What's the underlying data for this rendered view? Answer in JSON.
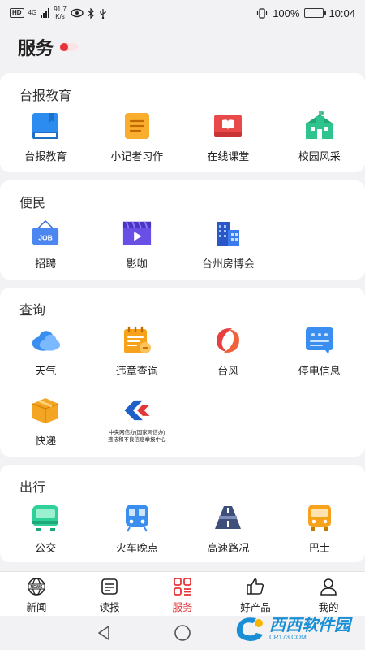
{
  "status": {
    "hd": "HD",
    "net": "4G",
    "speed": "91.7\nK/s",
    "battery": "100%",
    "time": "10:04"
  },
  "page": {
    "title": "服务"
  },
  "sections": [
    {
      "title": "台报教育",
      "items": [
        {
          "label": "台报教育",
          "icon": "book-icon"
        },
        {
          "label": "小记者习作",
          "icon": "notepad-icon"
        },
        {
          "label": "在线课堂",
          "icon": "open-book-icon"
        },
        {
          "label": "校园风采",
          "icon": "school-icon"
        }
      ]
    },
    {
      "title": "便民",
      "items": [
        {
          "label": "招聘",
          "icon": "job-sign-icon"
        },
        {
          "label": "影咖",
          "icon": "video-icon"
        },
        {
          "label": "台州房博会",
          "icon": "buildings-icon"
        }
      ]
    },
    {
      "title": "查询",
      "items": [
        {
          "label": "天气",
          "icon": "cloud-icon"
        },
        {
          "label": "违章查询",
          "icon": "ticket-icon"
        },
        {
          "label": "台风",
          "icon": "typhoon-icon"
        },
        {
          "label": "停电信息",
          "icon": "message-icon"
        },
        {
          "label": "快递",
          "icon": "parcel-icon"
        },
        {
          "label": "中央网信办(国家网信办)\n违法和不良信息举报中心",
          "icon": "report-logo-icon"
        }
      ]
    },
    {
      "title": "出行",
      "items": [
        {
          "label": "公交",
          "icon": "bus-icon"
        },
        {
          "label": "火车晚点",
          "icon": "train-icon"
        },
        {
          "label": "高速路况",
          "icon": "highway-icon"
        },
        {
          "label": "巴士",
          "icon": "school-bus-icon"
        }
      ]
    }
  ],
  "tabs": [
    {
      "label": "新闻",
      "icon": "globe-news-icon",
      "active": false
    },
    {
      "label": "读报",
      "icon": "newspaper-icon",
      "active": false
    },
    {
      "label": "服务",
      "icon": "grid-icon",
      "active": true
    },
    {
      "label": "好产品",
      "icon": "thumbs-up-icon",
      "active": false
    },
    {
      "label": "我的",
      "icon": "user-icon",
      "active": false
    }
  ],
  "watermark": {
    "text": "西西软件园",
    "sub": "CR173.COM"
  },
  "colors": {
    "accent": "#e8333a",
    "card": "#ffffff",
    "background": "#f2f2f4"
  }
}
